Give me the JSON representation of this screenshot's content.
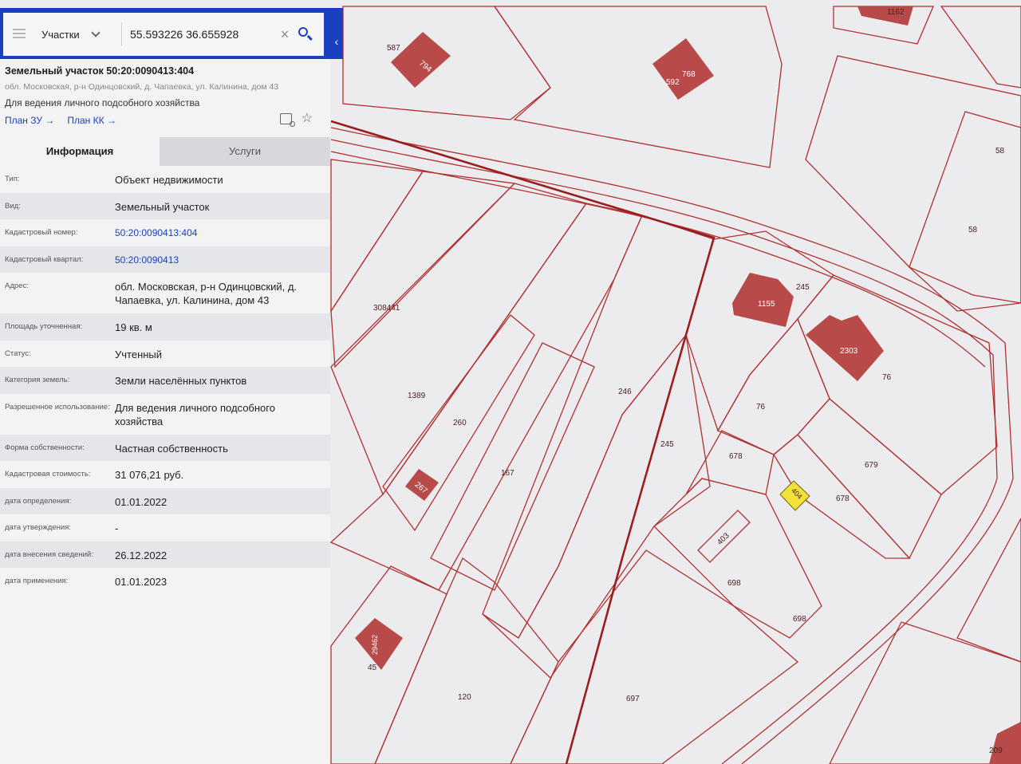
{
  "search": {
    "layer": "Участки",
    "query": "55.593226 36.655928"
  },
  "card": {
    "title": "Земельный участок 50:20:0090413:404",
    "address": "обл. Московская, р-н Одинцовский, д. Чапаевка, ул. Калинина, дом 43",
    "use": "Для ведения личного подсобного хозяйства",
    "link_plan_zu": "План ЗУ →",
    "link_plan_kk": "План КК →"
  },
  "tabs": [
    {
      "label": "Информация"
    },
    {
      "label": "Услуги"
    }
  ],
  "rows": [
    {
      "key": "Тип:",
      "value": "Объект недвижимости"
    },
    {
      "key": "Вид:",
      "value": "Земельный участок"
    },
    {
      "key": "Кадастровый номер:",
      "value": "50:20:0090413:404"
    },
    {
      "key": "Кадастровый квартал:",
      "value": "50:20:0090413"
    },
    {
      "key": "Адрес:",
      "value": "обл. Московская, р-н Одинцовский, д. Чапаевка, ул. Калинина, дом 43"
    },
    {
      "key": "Площадь уточненная:",
      "value": "19 кв. м"
    },
    {
      "key": "Статус:",
      "value": "Учтенный"
    },
    {
      "key": "Категория земель:",
      "value": "Земли населённых пунктов"
    },
    {
      "key": "Разрешенное использование:",
      "value": "Для ведения личного подсобного хозяйства"
    },
    {
      "key": "Форма собственности:",
      "value": "Частная собственность"
    },
    {
      "key": "Кадастровая стоимость:",
      "value": "31 076,21 руб."
    },
    {
      "key": "дата определения:",
      "value": "01.01.2022"
    },
    {
      "key": "дата утверждения:",
      "value": "-"
    },
    {
      "key": "дата внесения сведений:",
      "value": "26.12.2022"
    },
    {
      "key": "дата применения:",
      "value": "01.01.2023"
    }
  ],
  "map_labels": {
    "l587": "587",
    "l794": "794",
    "l592": "592",
    "l768": "768",
    "l1162": "1162",
    "l58a": "58",
    "l58b": "58",
    "l308441": "308441",
    "l245a": "245",
    "l1155": "1155",
    "l2303": "2303",
    "l76a": "76",
    "l76b": "76",
    "l1389": "1389",
    "l260": "260",
    "l246": "246",
    "l245b": "245",
    "l678a": "678",
    "l679": "679",
    "l404": "404",
    "l678b": "678",
    "l167": "167",
    "l267": "267",
    "l403": "403",
    "l698a": "698",
    "l698b": "698",
    "l29462": "29462",
    "l45": "45",
    "l120": "120",
    "l697": "697",
    "l209": "209"
  },
  "colors": {
    "parcel_line": "#b03030",
    "building_fill": "#b84a4a",
    "selected_fill": "#f2e23a",
    "accent": "#1a3fbf"
  }
}
